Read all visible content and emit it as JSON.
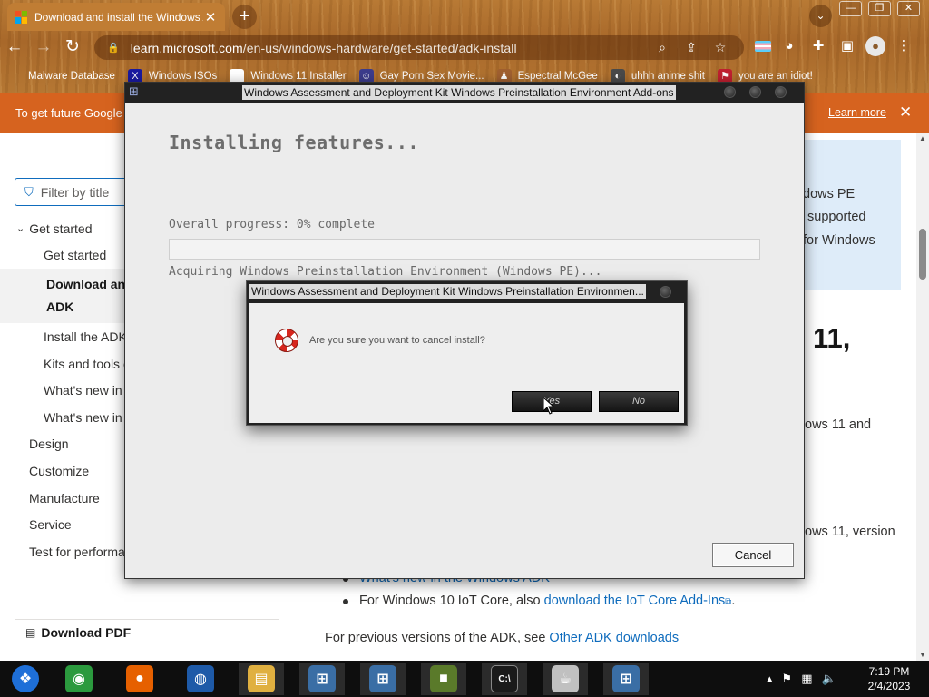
{
  "browser": {
    "tab": {
      "title": "Download and install the Windows A",
      "close": "✕"
    },
    "new_tab": "+",
    "tab_search": "⌄",
    "window_buttons": [
      "—",
      "❐",
      "✕"
    ],
    "url_host": "learn.microsoft.com",
    "url_path": "/en-us/windows-hardware/get-started/adk-install",
    "bookmarks": [
      {
        "label": "Malware Database",
        "icon": "bookmark-icon",
        "color": "#ffffff"
      },
      {
        "label": "Windows ISOs",
        "icon": "x-logo-icon",
        "color": "#1a1aa0"
      },
      {
        "label": "Windows 11 Installer",
        "icon": "image-icon",
        "color": "#ffffff"
      },
      {
        "label": "Gay Porn Sex Movie...",
        "icon": "face-icon",
        "color": "#3c3c8c"
      },
      {
        "label": "Espectral McGee",
        "icon": "figure-icon",
        "color": "#a06030"
      },
      {
        "label": "uhhh anime shit",
        "icon": "anime-icon",
        "color": "#4a4a4a"
      },
      {
        "label": "you are an idiot!",
        "icon": "flag-icon",
        "color": "#c02030"
      }
    ]
  },
  "webpage": {
    "banner_text": "To get future Google",
    "banner_learn_more": "Learn more",
    "filter_placeholder": "Filter by title",
    "nav": [
      {
        "label": "Get started",
        "level": 0,
        "expanded": true
      },
      {
        "label": "Get started",
        "level": 1
      },
      {
        "label": "Download and install the ADK",
        "level": 1,
        "active": true,
        "display": "Download an\nADK"
      },
      {
        "label": "Install the ADK",
        "level": 1
      },
      {
        "label": "Kits and tools o",
        "level": 1
      },
      {
        "label": "What's new in",
        "level": 1
      },
      {
        "label": "What's new in",
        "level": 1
      },
      {
        "label": "Design",
        "level": 0
      },
      {
        "label": "Customize",
        "level": 0
      },
      {
        "label": "Manufacture",
        "level": 0
      },
      {
        "label": "Service",
        "level": 0
      },
      {
        "label": "Test for performa",
        "level": 0
      }
    ],
    "download_pdf": "Download PDF",
    "note_lines": [
      "dows PE",
      "supported",
      "for Windows"
    ],
    "heading_fragment": "11,",
    "fragments": [
      "ows 11 and",
      "ows 11, version"
    ],
    "list_items": [
      {
        "text": "What's new in the Windows ADK",
        "link": true
      },
      {
        "prefix": "For Windows 10 IoT Core, also ",
        "link_text": "download the IoT Core Add-Ins",
        "suffix": "."
      }
    ],
    "previous_prefix": "For previous versions of the ADK, see ",
    "previous_link": "Other ADK downloads"
  },
  "installer": {
    "title": "Windows Assessment and Deployment Kit Windows Preinstallation Environment Add-ons",
    "heading": "Installing features...",
    "progress_label": "Overall progress: 0% complete",
    "progress_percent": 0,
    "status": "Acquiring Windows Preinstallation Environment (Windows PE)...",
    "cancel_label": "Cancel",
    "accent": "#2a8a2a"
  },
  "dialog": {
    "title": "Windows Assessment and Deployment Kit Windows Preinstallation Environmen...",
    "message": "Are you sure you want to cancel install?",
    "yes_label": "Yes",
    "no_label": "No"
  },
  "taskbar": {
    "apps": [
      {
        "name": "start-orb",
        "glyph": "❖",
        "color": "#1e6fd8"
      },
      {
        "name": "chrome",
        "glyph": "◉",
        "color": "#2b9a3e"
      },
      {
        "name": "firefox",
        "glyph": "●",
        "color": "#e66000"
      },
      {
        "name": "obama",
        "glyph": "◍",
        "color": "#1e5aa8"
      },
      {
        "name": "file-explorer",
        "glyph": "▤",
        "color": "#e0b040"
      },
      {
        "name": "adk-installer",
        "glyph": "⊞",
        "color": "#3a6ea5"
      },
      {
        "name": "adk-installer-2",
        "glyph": "⊞",
        "color": "#3a6ea5"
      },
      {
        "name": "minecraft",
        "glyph": "■",
        "color": "#5a7a2a"
      },
      {
        "name": "command-prompt",
        "glyph": "C:\\",
        "color": "#1a1a1a"
      },
      {
        "name": "java",
        "glyph": "☕",
        "color": "#c0c0c0"
      },
      {
        "name": "adk-installer-3",
        "glyph": "⊞",
        "color": "#3a6ea5"
      }
    ],
    "time": "7:19 PM",
    "date": "2/4/2023"
  }
}
